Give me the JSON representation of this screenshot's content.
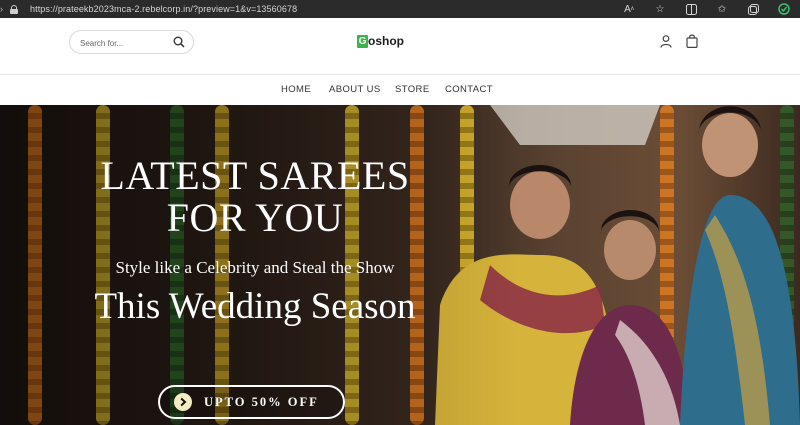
{
  "browser": {
    "url": "https://prateekb2023mca-2.rebelcorp.in/?preview=1&v=13560678",
    "icons": [
      "read-aloud-icon",
      "star-icon",
      "split-screen-icon",
      "favorites-icon",
      "collections-icon",
      "extension-icon"
    ]
  },
  "header": {
    "search_placeholder": "Search for...",
    "logo_mark": "G",
    "logo_text": "oshop"
  },
  "nav": {
    "items": [
      "HOME",
      "ABOUT US",
      "STORE",
      "CONTACT"
    ]
  },
  "hero": {
    "title_line1": "LATEST SAREES",
    "title_line2": "FOR YOU",
    "subtitle": "Style like a Celebrity and Steal the Show",
    "season": "This Wedding Season",
    "button_label": "UPTO 50% OFF"
  },
  "colors": {
    "brand_green": "#3bb54a",
    "offer_circle": "#f3ecc0"
  }
}
